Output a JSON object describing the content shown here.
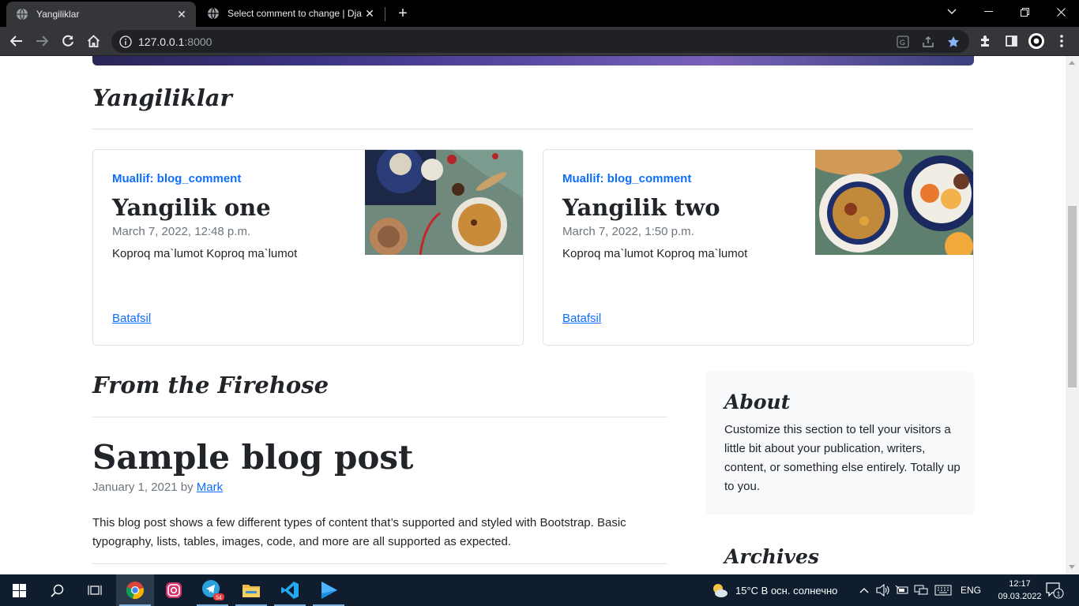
{
  "browser": {
    "tabs": [
      {
        "title": "Yangiliklar",
        "active": true
      },
      {
        "title": "Select comment to change | Djan",
        "active": false
      }
    ],
    "new_tab": "+",
    "url_host": "127.0.0.1",
    "url_port": ":8000"
  },
  "page": {
    "news_heading": "Yangiliklar",
    "cards": [
      {
        "author": "Muallif: blog_comment",
        "title": "Yangilik one",
        "date": "March 7, 2022, 12:48 p.m.",
        "text": "Koproq ma`lumot Koproq ma`lumot",
        "link": "Batafsil"
      },
      {
        "author": "Muallif: blog_comment",
        "title": "Yangilik two",
        "date": "March 7, 2022, 1:50 p.m.",
        "text": "Koproq ma`lumot Koproq ma`lumot",
        "link": "Batafsil"
      }
    ],
    "firehose_heading": "From the Firehose",
    "post": {
      "title": "Sample blog post",
      "date_prefix": "January 1, 2021 by ",
      "author": "Mark",
      "body": "This blog post shows a few different types of content that’s supported and styled with Bootstrap. Basic typography, lists, tables, images, code, and more are all supported as expected."
    },
    "sidebar": {
      "about_title": "About",
      "about_text": "Customize this section to tell your visitors a little bit about your publication, writers, content, or something else entirely. Totally up to you.",
      "archives_title": "Archives"
    }
  },
  "taskbar": {
    "weather": "15°C  В осн. солнечно",
    "lang": "ENG",
    "time": "12:17",
    "date": "09.03.2022",
    "telegram_badge": "54",
    "notification_count": "1"
  },
  "colors": {
    "link": "#0d6efd",
    "muted": "#6c757d",
    "chrome_dark": "#35363a"
  }
}
